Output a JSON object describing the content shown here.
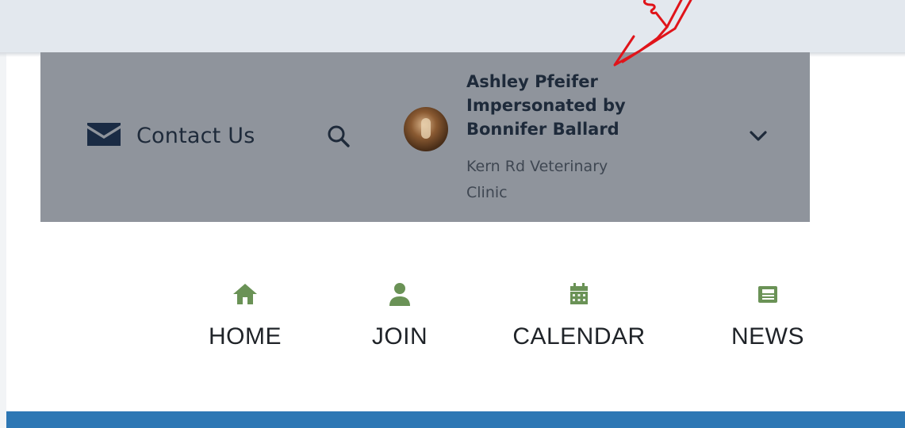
{
  "header": {
    "contact_label": "Contact Us",
    "user": {
      "name_lines": [
        "Ashley Pfeifer",
        "Impersonated by",
        "Bonnifer Ballard"
      ],
      "org_lines": [
        "Kern Rd Veterinary",
        "Clinic"
      ]
    }
  },
  "icons": {
    "contact": "envelope-icon",
    "search": "search-icon",
    "dropdown": "chevron-down-icon",
    "home": "home-icon",
    "join": "user-icon",
    "calendar": "calendar-icon",
    "news": "newspaper-icon"
  },
  "nav": {
    "items": [
      {
        "label": "HOME"
      },
      {
        "label": "JOIN"
      },
      {
        "label": "CALENDAR"
      },
      {
        "label": "NEWS"
      }
    ]
  },
  "colors": {
    "header_bar": "#8f949c",
    "nav_icon": "#6a9256",
    "bottom_band": "#2d77b4",
    "annotation": "#e0141a",
    "text_dark": "#1e2a3a"
  }
}
